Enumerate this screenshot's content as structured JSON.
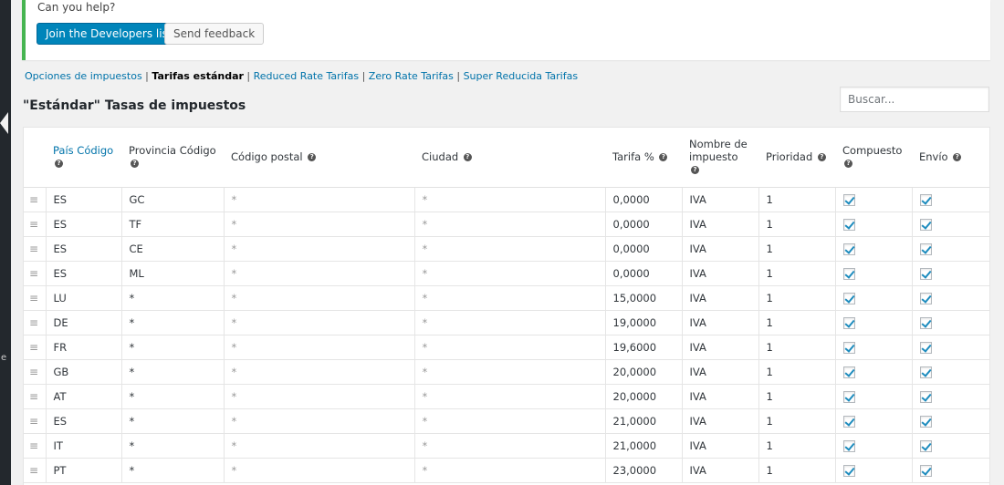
{
  "notice": {
    "help_text": "Can you help?",
    "primary_button": "Join the Developers list",
    "secondary_button": "Send feedback"
  },
  "subnav": {
    "items": [
      {
        "label": "Opciones de impuestos",
        "current": false
      },
      {
        "label": "Tarifas estándar",
        "current": true
      },
      {
        "label": "Reduced Rate Tarifas",
        "current": false
      },
      {
        "label": "Zero Rate Tarifas",
        "current": false
      },
      {
        "label": "Super Reducida Tarifas",
        "current": false
      }
    ]
  },
  "page_title": "\"Estándar\" Tasas de impuestos",
  "search": {
    "placeholder": "Buscar..."
  },
  "table": {
    "headers": {
      "country": "País Código",
      "state": "Provincia Código",
      "postcode": "Código postal",
      "city": "Ciudad",
      "rate": "Tarifa %",
      "name_line1": "Nombre de",
      "name_line2": "impuesto",
      "priority": "Prioridad",
      "compound": "Compuesto",
      "shipping": "Envío"
    },
    "rows": [
      {
        "country": "ES",
        "state": "GC",
        "postcode": "*",
        "city": "*",
        "rate": "0,0000",
        "name": "IVA",
        "priority": "1",
        "compound": true,
        "shipping": true
      },
      {
        "country": "ES",
        "state": "TF",
        "postcode": "*",
        "city": "*",
        "rate": "0,0000",
        "name": "IVA",
        "priority": "1",
        "compound": true,
        "shipping": true
      },
      {
        "country": "ES",
        "state": "CE",
        "postcode": "*",
        "city": "*",
        "rate": "0,0000",
        "name": "IVA",
        "priority": "1",
        "compound": true,
        "shipping": true
      },
      {
        "country": "ES",
        "state": "ML",
        "postcode": "*",
        "city": "*",
        "rate": "0,0000",
        "name": "IVA",
        "priority": "1",
        "compound": true,
        "shipping": true
      },
      {
        "country": "LU",
        "state": "*",
        "postcode": "*",
        "city": "*",
        "rate": "15,0000",
        "name": "IVA",
        "priority": "1",
        "compound": true,
        "shipping": true
      },
      {
        "country": "DE",
        "state": "*",
        "postcode": "*",
        "city": "*",
        "rate": "19,0000",
        "name": "IVA",
        "priority": "1",
        "compound": true,
        "shipping": true
      },
      {
        "country": "FR",
        "state": "*",
        "postcode": "*",
        "city": "*",
        "rate": "19,6000",
        "name": "IVA",
        "priority": "1",
        "compound": true,
        "shipping": true
      },
      {
        "country": "GB",
        "state": "*",
        "postcode": "*",
        "city": "*",
        "rate": "20,0000",
        "name": "IVA",
        "priority": "1",
        "compound": true,
        "shipping": true
      },
      {
        "country": "AT",
        "state": "*",
        "postcode": "*",
        "city": "*",
        "rate": "20,0000",
        "name": "IVA",
        "priority": "1",
        "compound": true,
        "shipping": true
      },
      {
        "country": "ES",
        "state": "*",
        "postcode": "*",
        "city": "*",
        "rate": "21,0000",
        "name": "IVA",
        "priority": "1",
        "compound": true,
        "shipping": true
      },
      {
        "country": "IT",
        "state": "*",
        "postcode": "*",
        "city": "*",
        "rate": "21,0000",
        "name": "IVA",
        "priority": "1",
        "compound": true,
        "shipping": true
      },
      {
        "country": "PT",
        "state": "*",
        "postcode": "*",
        "city": "*",
        "rate": "23,0000",
        "name": "IVA",
        "priority": "1",
        "compound": true,
        "shipping": true
      }
    ]
  },
  "colors": {
    "accent": "#0073aa",
    "primary_button": "#0085ba",
    "notice_border": "#46b450",
    "admin_bar": "#23282d"
  }
}
